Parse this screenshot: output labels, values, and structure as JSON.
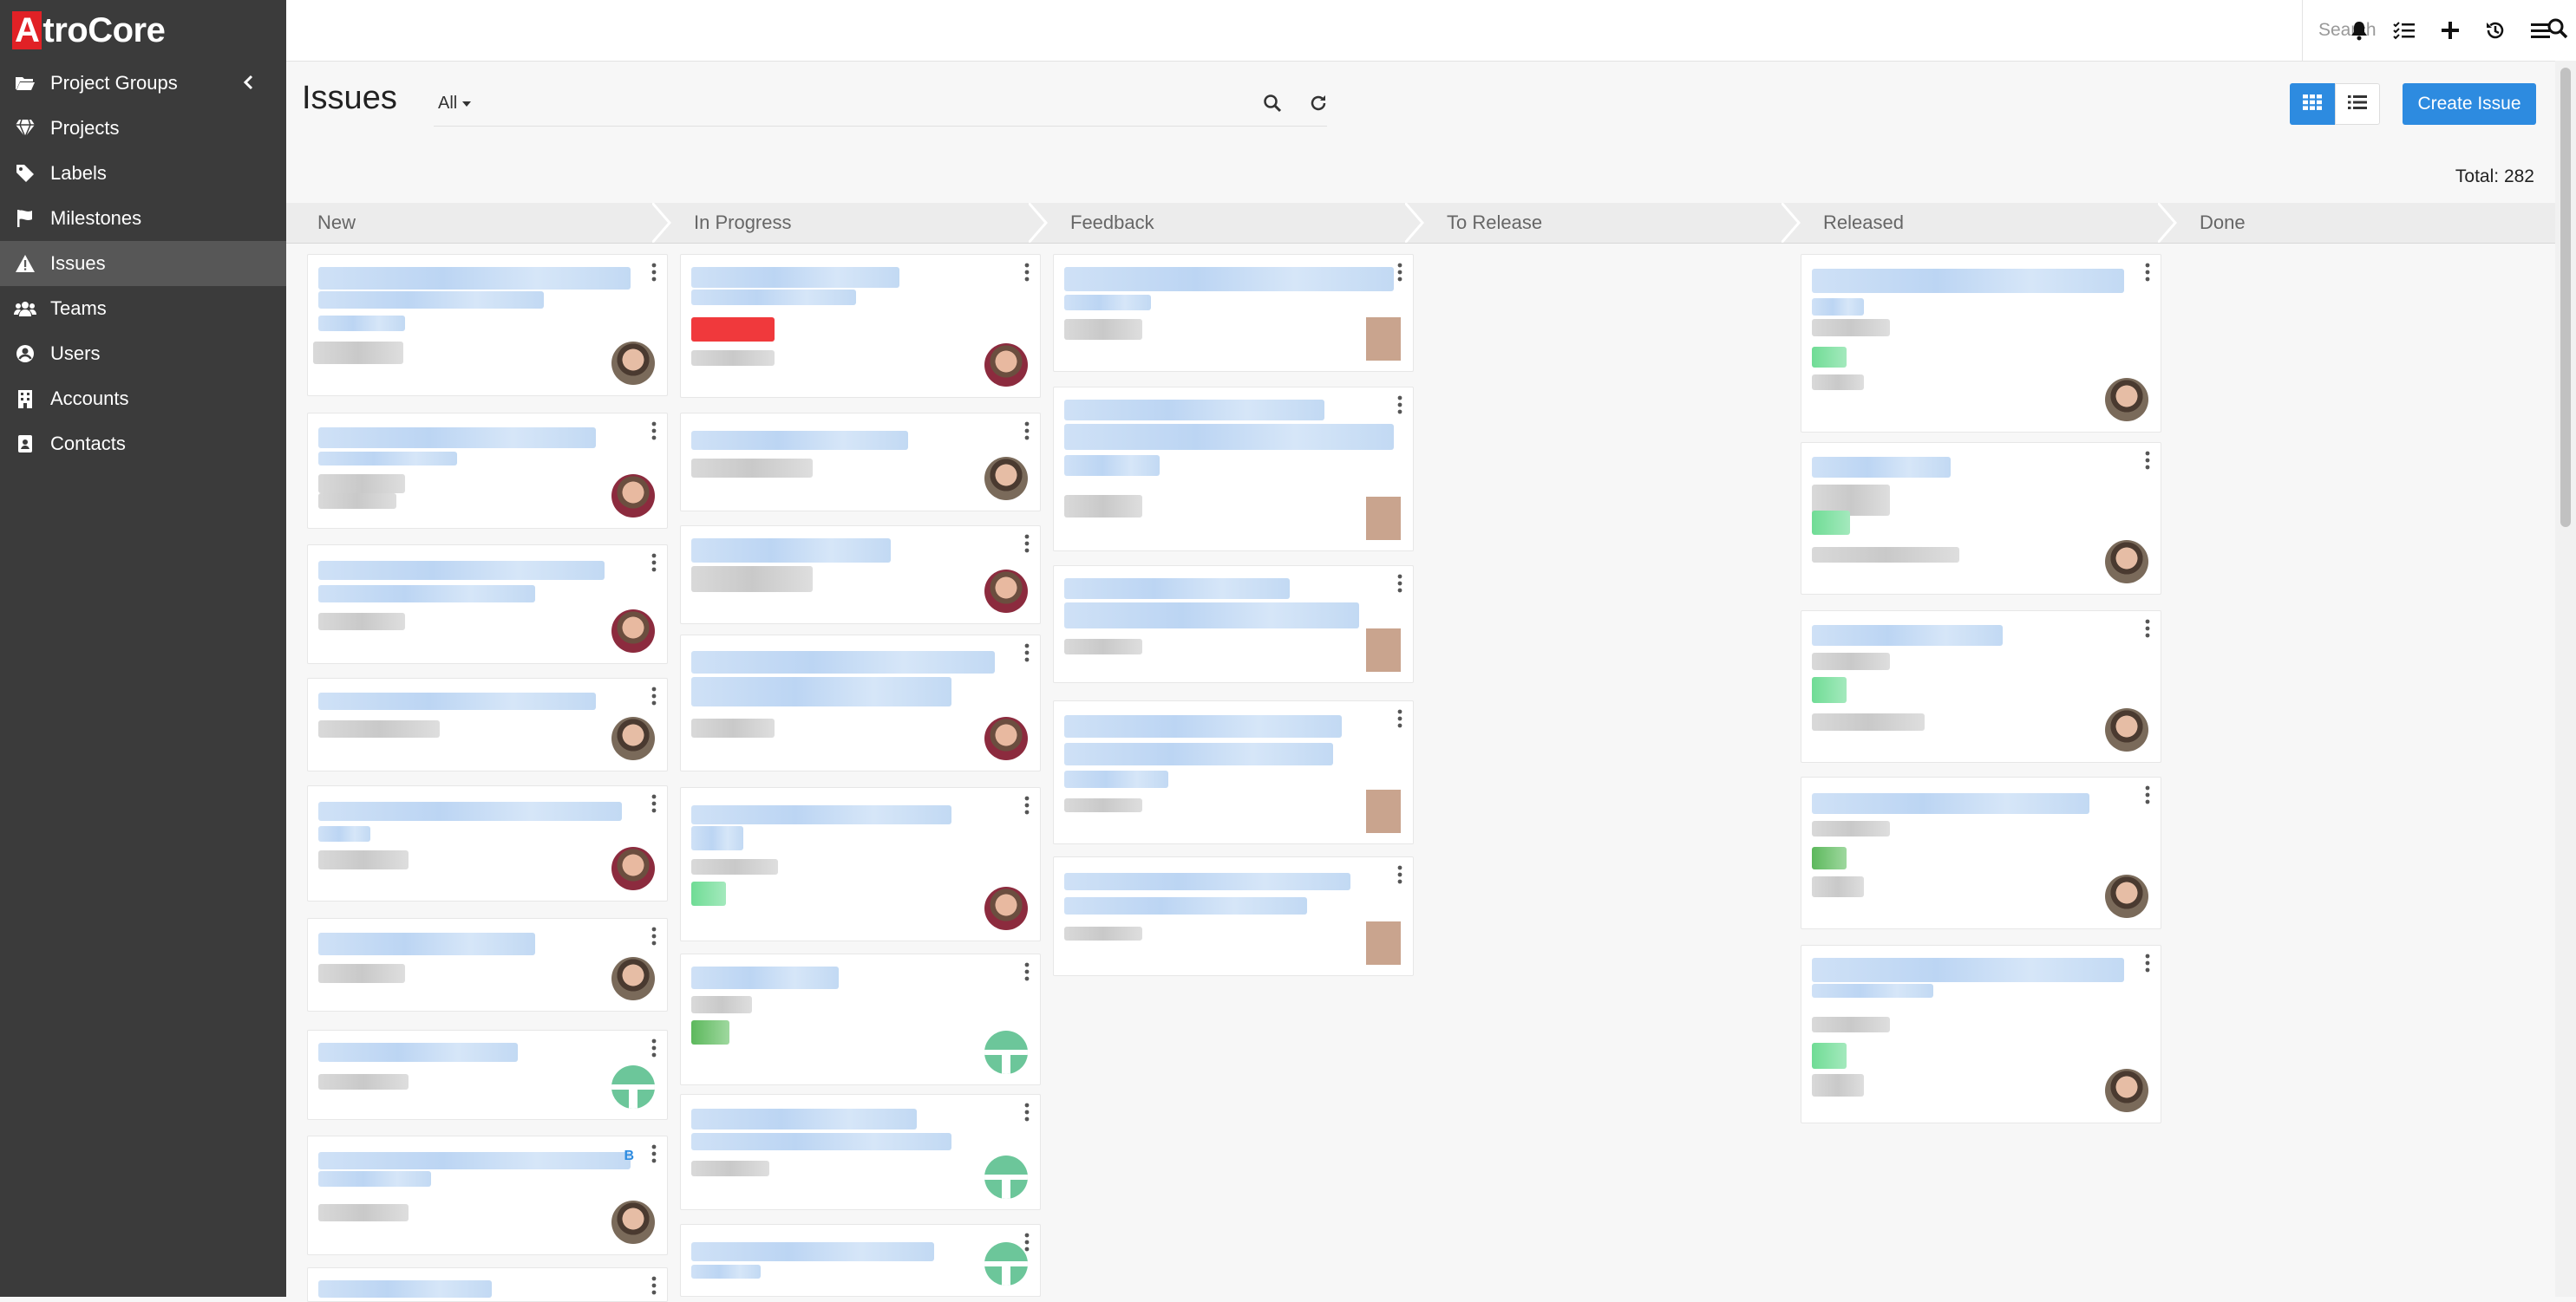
{
  "brand": {
    "logo_first": "A",
    "logo_rest": "troCore"
  },
  "sidebar": {
    "items": [
      {
        "label": "Project Groups",
        "icon": "folder-open-icon"
      },
      {
        "label": "Projects",
        "icon": "gem-icon"
      },
      {
        "label": "Labels",
        "icon": "tag-icon"
      },
      {
        "label": "Milestones",
        "icon": "flag-icon"
      },
      {
        "label": "Issues",
        "icon": "warning-triangle-icon",
        "active": true
      },
      {
        "label": "Teams",
        "icon": "users-icon"
      },
      {
        "label": "Users",
        "icon": "user-circle-icon"
      },
      {
        "label": "Accounts",
        "icon": "building-icon"
      },
      {
        "label": "Contacts",
        "icon": "address-card-icon"
      }
    ]
  },
  "topbar": {
    "search_placeholder": "Search"
  },
  "page": {
    "title": "Issues",
    "filter": "All",
    "create_button": "Create Issue",
    "total": "Total: 282"
  },
  "statuses": [
    "New",
    "In Progress",
    "Feedback",
    "To Release",
    "Released",
    "Done"
  ],
  "card_badge": "B",
  "colors": {
    "accent": "#2d8be0",
    "sidebar": "#3b3b3b",
    "logo_red": "#e12126"
  }
}
